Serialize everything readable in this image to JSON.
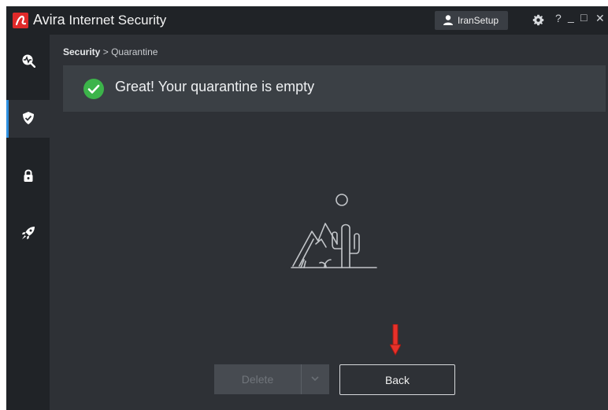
{
  "app": {
    "brand": "Avira",
    "product": "Internet Security"
  },
  "titlebar": {
    "user_label": "IranSetup",
    "icons": [
      "user-icon",
      "gear-icon",
      "help-icon",
      "minimize-icon",
      "maximize-icon",
      "close-icon"
    ],
    "help_glyph": "?",
    "minimize_glyph": "_",
    "maximize_glyph": "□",
    "close_glyph": "✕"
  },
  "sidebar": {
    "items": [
      {
        "name": "scan",
        "icon": "scan-icon",
        "active": false
      },
      {
        "name": "security",
        "icon": "shield-icon",
        "active": true
      },
      {
        "name": "privacy",
        "icon": "lock-icon",
        "active": false
      },
      {
        "name": "performance",
        "icon": "rocket-icon",
        "active": false
      }
    ]
  },
  "breadcrumb": {
    "items": [
      "Security",
      "Quarantine"
    ],
    "separator": ">"
  },
  "banner": {
    "message": "Great! Your quarantine is empty",
    "icon": "check-circle-icon",
    "icon_color": "#3cb44a"
  },
  "illustration": {
    "icon": "desert-empty-illustration"
  },
  "actions": {
    "delete_label": "Delete",
    "back_label": "Back",
    "delete_enabled": false
  },
  "annotation": {
    "icon": "red-down-arrow-icon",
    "color": "#e8312a"
  },
  "colors": {
    "accent": "#2d8fe0",
    "brand_red": "#e02a2a",
    "background": "#2e3136",
    "chrome": "#202327"
  }
}
